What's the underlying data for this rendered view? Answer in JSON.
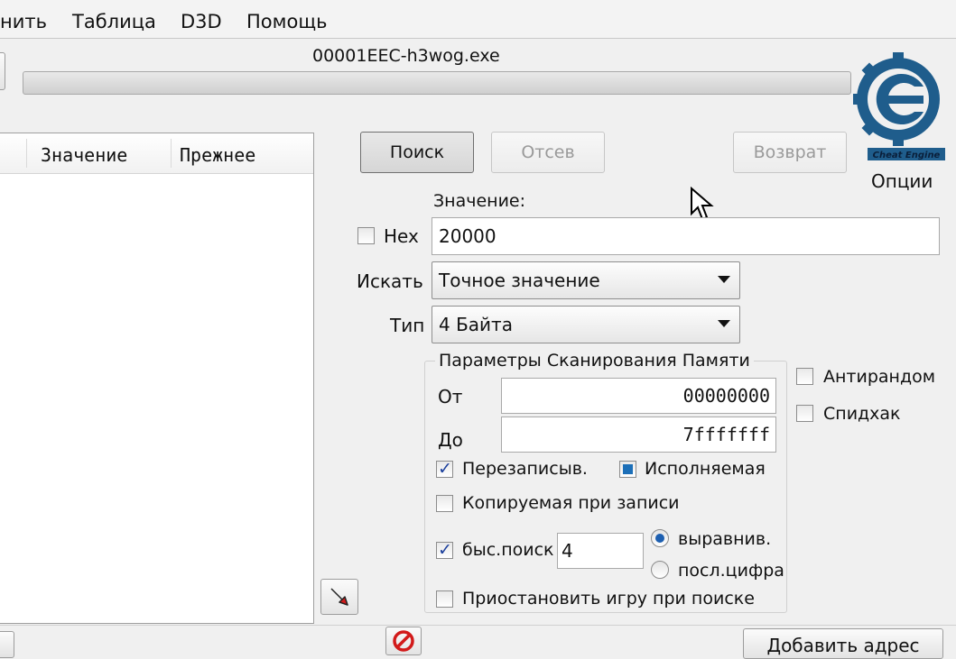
{
  "menu": {
    "items": [
      "нить",
      "Таблица",
      "D3D",
      "Помощь"
    ]
  },
  "process": {
    "name": "00001EEC-h3wog.exe",
    "progress": 0
  },
  "results_table": {
    "columns": [
      "Значение",
      "Прежнее"
    ]
  },
  "buttons": {
    "search": "Поиск",
    "filter": "Отсев",
    "undo": "Возврат",
    "add_address": "Добавить адрес"
  },
  "logo": {
    "options_label": "Опции",
    "brand": "Cheat Engine"
  },
  "value_field": {
    "label": "Значение:",
    "hex_label": "Hex",
    "value": "20000"
  },
  "scan_type": {
    "label": "Искать",
    "selected": "Точное значение"
  },
  "value_type": {
    "label": "Тип",
    "selected": "4 Байта"
  },
  "memory_scan": {
    "title": "Параметры Сканирования Памяти",
    "from_label": "От",
    "from_value": "00000000",
    "to_label": "До",
    "to_value": "7fffffff",
    "writable_label": "Перезаписыв.",
    "executable_label": "Исполняемая",
    "copy_on_write_label": "Копируемая при записи",
    "fast_scan_label": "быс.поиск",
    "fast_scan_value": "4",
    "align_label": "выравнив.",
    "last_digits_label": "посл.цифра",
    "pause_label": "Приостановить игру при поиске"
  },
  "extra": {
    "antirandom_label": "Антирандом",
    "speedhack_label": "Спидхак"
  },
  "colors": {
    "accent": "#1d5fb0",
    "logo": "#1f5d8c"
  }
}
